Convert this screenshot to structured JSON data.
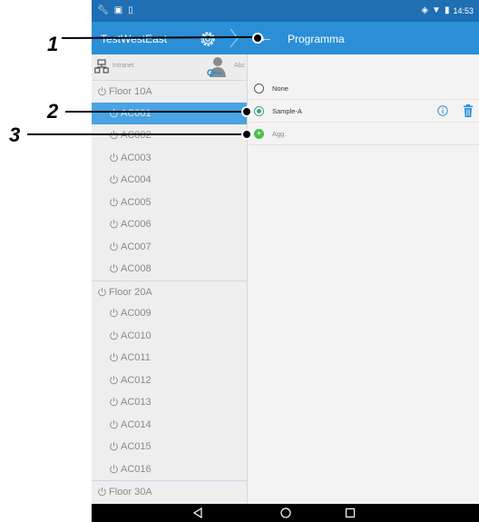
{
  "status_bar": {
    "time": "14:53"
  },
  "app_bar": {
    "app_title": "TestWestEast",
    "page_title": "Programma"
  },
  "left_panel": {
    "header": {
      "network_label": "Intranet",
      "user_label": "Abc"
    },
    "tree": [
      {
        "type": "floor",
        "label": "Floor 10A"
      },
      {
        "type": "unit",
        "label": "AC001",
        "selected": true
      },
      {
        "type": "unit",
        "label": "AC002"
      },
      {
        "type": "unit",
        "label": "AC003"
      },
      {
        "type": "unit",
        "label": "AC004"
      },
      {
        "type": "unit",
        "label": "AC005"
      },
      {
        "type": "unit",
        "label": "AC006"
      },
      {
        "type": "unit",
        "label": "AC007"
      },
      {
        "type": "unit",
        "label": "AC008"
      },
      {
        "type": "floor",
        "label": "Floor 20A"
      },
      {
        "type": "unit",
        "label": "AC009"
      },
      {
        "type": "unit",
        "label": "AC010"
      },
      {
        "type": "unit",
        "label": "AC011"
      },
      {
        "type": "unit",
        "label": "AC012"
      },
      {
        "type": "unit",
        "label": "AC013"
      },
      {
        "type": "unit",
        "label": "AC014"
      },
      {
        "type": "unit",
        "label": "AC015"
      },
      {
        "type": "unit",
        "label": "AC016"
      },
      {
        "type": "floor",
        "label": "Floor 30A"
      }
    ]
  },
  "program_list": {
    "none_label": "None",
    "program_label": "Sample-A",
    "add_label": "Agg."
  },
  "callouts": [
    "1",
    "2",
    "3"
  ],
  "colors": {
    "status_bar": "#1f6fb2",
    "app_bar": "#2b8fd8",
    "selected_row": "#4aa3e2",
    "radio_on": "#3a9e8a",
    "add_green": "#4cbf4c",
    "trash_blue": "#2b8fd8"
  },
  "icons": [
    "wrench-icon",
    "image-icon",
    "document-icon",
    "vibrate-icon",
    "wifi-icon",
    "battery-icon",
    "gear-icon",
    "chevron-right-icon",
    "back-arrow-icon",
    "network-icon",
    "user-key-icon",
    "power-icon",
    "info-icon",
    "trash-icon",
    "add-icon",
    "nav-back-icon",
    "nav-home-icon",
    "nav-recents-icon"
  ]
}
